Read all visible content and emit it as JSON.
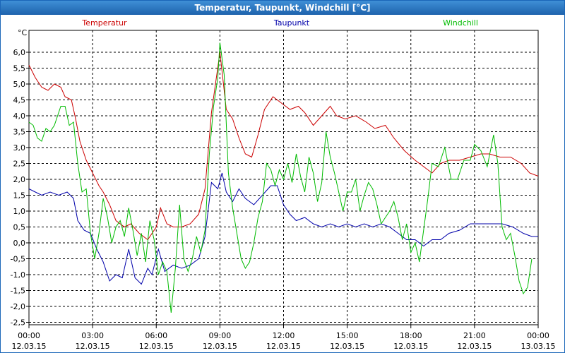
{
  "window": {
    "title": "Temperatur, Taupunkt, Windchill [°C]"
  },
  "chart_data": {
    "type": "line",
    "title": "Temperatur, Taupunkt, Windchill [°C]",
    "ylabel": "°C",
    "xlim": [
      0,
      24
    ],
    "ylim": [
      -2.5,
      6.5
    ],
    "grid": true,
    "y_ticks": [
      "-2,5",
      "-2,0",
      "-1,5",
      "-1,0",
      "-0,5",
      "0,0",
      "0,5",
      "1,0",
      "1,5",
      "2,0",
      "2,5",
      "3,0",
      "3,5",
      "4,0",
      "4,5",
      "5,0",
      "5,5",
      "6,0"
    ],
    "x_ticks": [
      {
        "time": "00:00",
        "date": "12.03.15"
      },
      {
        "time": "03:00",
        "date": "12.03.15"
      },
      {
        "time": "06:00",
        "date": "12.03.15"
      },
      {
        "time": "09:00",
        "date": "12.03.15"
      },
      {
        "time": "12:00",
        "date": "12.03.15"
      },
      {
        "time": "15:00",
        "date": "12.03.15"
      },
      {
        "time": "18:00",
        "date": "12.03.15"
      },
      {
        "time": "21:00",
        "date": "12.03.15"
      },
      {
        "time": "00:00",
        "date": "13.03.15"
      }
    ],
    "series": [
      {
        "name": "Temperatur",
        "color": "#cc0000",
        "points": [
          [
            0,
            5.6
          ],
          [
            0.3,
            5.2
          ],
          [
            0.6,
            4.9
          ],
          [
            0.9,
            4.8
          ],
          [
            1.2,
            5.0
          ],
          [
            1.5,
            4.9
          ],
          [
            1.7,
            4.6
          ],
          [
            2.0,
            4.5
          ],
          [
            2.2,
            3.9
          ],
          [
            2.4,
            3.2
          ],
          [
            2.7,
            2.6
          ],
          [
            3.0,
            2.2
          ],
          [
            3.3,
            1.8
          ],
          [
            3.5,
            1.6
          ],
          [
            3.8,
            1.2
          ],
          [
            4.1,
            0.7
          ],
          [
            4.5,
            0.5
          ],
          [
            4.8,
            0.6
          ],
          [
            5.2,
            0.3
          ],
          [
            5.6,
            0.1
          ],
          [
            6.0,
            0.5
          ],
          [
            6.2,
            1.1
          ],
          [
            6.5,
            0.6
          ],
          [
            6.8,
            0.5
          ],
          [
            7.2,
            0.5
          ],
          [
            7.6,
            0.6
          ],
          [
            8.0,
            0.9
          ],
          [
            8.3,
            1.7
          ],
          [
            8.6,
            4.1
          ],
          [
            9.0,
            6.0
          ],
          [
            9.3,
            4.2
          ],
          [
            9.6,
            3.9
          ],
          [
            9.9,
            3.3
          ],
          [
            10.2,
            2.8
          ],
          [
            10.5,
            2.7
          ],
          [
            10.8,
            3.4
          ],
          [
            11.1,
            4.2
          ],
          [
            11.5,
            4.6
          ],
          [
            11.9,
            4.4
          ],
          [
            12.3,
            4.2
          ],
          [
            12.7,
            4.3
          ],
          [
            13.0,
            4.1
          ],
          [
            13.4,
            3.7
          ],
          [
            13.8,
            4.0
          ],
          [
            14.2,
            4.3
          ],
          [
            14.5,
            4.0
          ],
          [
            14.9,
            3.9
          ],
          [
            15.4,
            4.0
          ],
          [
            15.9,
            3.8
          ],
          [
            16.3,
            3.6
          ],
          [
            16.8,
            3.7
          ],
          [
            17.2,
            3.3
          ],
          [
            17.7,
            2.9
          ],
          [
            18.2,
            2.6
          ],
          [
            18.6,
            2.4
          ],
          [
            19.0,
            2.2
          ],
          [
            19.4,
            2.5
          ],
          [
            19.8,
            2.6
          ],
          [
            20.3,
            2.6
          ],
          [
            20.8,
            2.7
          ],
          [
            21.3,
            2.8
          ],
          [
            21.7,
            2.8
          ],
          [
            22.2,
            2.7
          ],
          [
            22.7,
            2.7
          ],
          [
            23.2,
            2.5
          ],
          [
            23.6,
            2.2
          ],
          [
            24.0,
            2.1
          ]
        ]
      },
      {
        "name": "Taupunkt",
        "color": "#0000aa",
        "points": [
          [
            0,
            1.7
          ],
          [
            0.3,
            1.6
          ],
          [
            0.6,
            1.5
          ],
          [
            1.0,
            1.6
          ],
          [
            1.4,
            1.5
          ],
          [
            1.8,
            1.6
          ],
          [
            2.1,
            1.4
          ],
          [
            2.3,
            0.7
          ],
          [
            2.6,
            0.4
          ],
          [
            2.9,
            0.3
          ],
          [
            3.2,
            -0.2
          ],
          [
            3.5,
            -0.6
          ],
          [
            3.8,
            -1.2
          ],
          [
            4.1,
            -1.0
          ],
          [
            4.4,
            -1.1
          ],
          [
            4.7,
            -0.2
          ],
          [
            5.0,
            -1.1
          ],
          [
            5.3,
            -1.3
          ],
          [
            5.6,
            -0.8
          ],
          [
            5.8,
            -1.0
          ],
          [
            6.1,
            -0.2
          ],
          [
            6.4,
            -0.9
          ],
          [
            6.8,
            -0.7
          ],
          [
            7.2,
            -0.8
          ],
          [
            7.6,
            -0.7
          ],
          [
            8.0,
            -0.5
          ],
          [
            8.3,
            0.2
          ],
          [
            8.6,
            1.9
          ],
          [
            8.9,
            1.7
          ],
          [
            9.1,
            2.2
          ],
          [
            9.3,
            1.6
          ],
          [
            9.6,
            1.3
          ],
          [
            9.9,
            1.7
          ],
          [
            10.2,
            1.4
          ],
          [
            10.6,
            1.2
          ],
          [
            11.0,
            1.5
          ],
          [
            11.4,
            1.8
          ],
          [
            11.7,
            1.8
          ],
          [
            12.0,
            1.2
          ],
          [
            12.3,
            0.9
          ],
          [
            12.6,
            0.7
          ],
          [
            13.0,
            0.8
          ],
          [
            13.4,
            0.6
          ],
          [
            13.8,
            0.5
          ],
          [
            14.2,
            0.6
          ],
          [
            14.6,
            0.5
          ],
          [
            15.0,
            0.6
          ],
          [
            15.4,
            0.5
          ],
          [
            15.8,
            0.6
          ],
          [
            16.2,
            0.5
          ],
          [
            16.6,
            0.6
          ],
          [
            17.0,
            0.5
          ],
          [
            17.4,
            0.3
          ],
          [
            17.8,
            0.1
          ],
          [
            18.2,
            0.1
          ],
          [
            18.6,
            -0.1
          ],
          [
            19.0,
            0.1
          ],
          [
            19.4,
            0.1
          ],
          [
            19.8,
            0.3
          ],
          [
            20.3,
            0.4
          ],
          [
            20.8,
            0.6
          ],
          [
            21.3,
            0.6
          ],
          [
            21.8,
            0.6
          ],
          [
            22.3,
            0.6
          ],
          [
            22.8,
            0.5
          ],
          [
            23.3,
            0.3
          ],
          [
            23.7,
            0.2
          ],
          [
            24.0,
            0.2
          ]
        ]
      },
      {
        "name": "Windchill",
        "color": "#00bb00",
        "points": [
          [
            0,
            3.8
          ],
          [
            0.2,
            3.7
          ],
          [
            0.4,
            3.3
          ],
          [
            0.6,
            3.2
          ],
          [
            0.8,
            3.6
          ],
          [
            1.0,
            3.5
          ],
          [
            1.2,
            3.7
          ],
          [
            1.5,
            4.3
          ],
          [
            1.7,
            4.3
          ],
          [
            1.9,
            3.7
          ],
          [
            2.1,
            3.8
          ],
          [
            2.3,
            2.5
          ],
          [
            2.5,
            1.6
          ],
          [
            2.7,
            1.7
          ],
          [
            2.9,
            0.3
          ],
          [
            3.1,
            -0.5
          ],
          [
            3.3,
            0.3
          ],
          [
            3.5,
            1.4
          ],
          [
            3.7,
            0.8
          ],
          [
            3.9,
            0.0
          ],
          [
            4.1,
            0.5
          ],
          [
            4.3,
            0.7
          ],
          [
            4.5,
            0.2
          ],
          [
            4.7,
            1.1
          ],
          [
            4.9,
            0.4
          ],
          [
            5.1,
            -0.4
          ],
          [
            5.3,
            0.3
          ],
          [
            5.5,
            -0.6
          ],
          [
            5.7,
            0.7
          ],
          [
            5.9,
            0.1
          ],
          [
            6.1,
            -1.0
          ],
          [
            6.3,
            -0.6
          ],
          [
            6.5,
            -0.9
          ],
          [
            6.7,
            -2.2
          ],
          [
            6.9,
            -0.8
          ],
          [
            7.1,
            1.2
          ],
          [
            7.3,
            -0.5
          ],
          [
            7.5,
            -0.9
          ],
          [
            7.7,
            -0.5
          ],
          [
            7.9,
            0.2
          ],
          [
            8.1,
            -0.3
          ],
          [
            8.3,
            0.4
          ],
          [
            8.5,
            2.8
          ],
          [
            8.7,
            4.3
          ],
          [
            8.9,
            5.2
          ],
          [
            9.0,
            6.3
          ],
          [
            9.2,
            5.3
          ],
          [
            9.4,
            2.2
          ],
          [
            9.6,
            1.1
          ],
          [
            9.8,
            0.3
          ],
          [
            10.0,
            -0.5
          ],
          [
            10.2,
            -0.8
          ],
          [
            10.4,
            -0.6
          ],
          [
            10.6,
            0.0
          ],
          [
            10.8,
            0.8
          ],
          [
            11.0,
            1.3
          ],
          [
            11.2,
            2.5
          ],
          [
            11.4,
            2.3
          ],
          [
            11.6,
            1.8
          ],
          [
            11.8,
            2.3
          ],
          [
            12.0,
            2.0
          ],
          [
            12.2,
            2.5
          ],
          [
            12.4,
            1.9
          ],
          [
            12.6,
            2.8
          ],
          [
            12.8,
            2.1
          ],
          [
            13.0,
            1.6
          ],
          [
            13.2,
            2.7
          ],
          [
            13.4,
            2.2
          ],
          [
            13.6,
            1.3
          ],
          [
            13.8,
            1.9
          ],
          [
            14.0,
            3.5
          ],
          [
            14.2,
            2.7
          ],
          [
            14.4,
            2.2
          ],
          [
            14.6,
            1.6
          ],
          [
            14.8,
            1.0
          ],
          [
            15.0,
            1.6
          ],
          [
            15.2,
            1.6
          ],
          [
            15.4,
            2.0
          ],
          [
            15.6,
            1.0
          ],
          [
            15.8,
            1.5
          ],
          [
            16.0,
            1.9
          ],
          [
            16.2,
            1.7
          ],
          [
            16.4,
            1.2
          ],
          [
            16.6,
            0.6
          ],
          [
            16.8,
            0.8
          ],
          [
            17.0,
            1.0
          ],
          [
            17.2,
            1.3
          ],
          [
            17.4,
            0.8
          ],
          [
            17.6,
            0.1
          ],
          [
            17.8,
            0.6
          ],
          [
            18.0,
            -0.3
          ],
          [
            18.2,
            0.0
          ],
          [
            18.4,
            -0.6
          ],
          [
            18.6,
            0.4
          ],
          [
            18.8,
            1.4
          ],
          [
            19.0,
            2.5
          ],
          [
            19.3,
            2.4
          ],
          [
            19.6,
            3.0
          ],
          [
            19.9,
            2.0
          ],
          [
            20.2,
            2.0
          ],
          [
            20.5,
            2.6
          ],
          [
            20.8,
            2.6
          ],
          [
            21.0,
            3.1
          ],
          [
            21.3,
            2.9
          ],
          [
            21.6,
            2.4
          ],
          [
            21.9,
            3.4
          ],
          [
            22.1,
            2.5
          ],
          [
            22.3,
            0.5
          ],
          [
            22.5,
            0.1
          ],
          [
            22.7,
            0.3
          ],
          [
            22.9,
            -0.4
          ],
          [
            23.1,
            -1.2
          ],
          [
            23.3,
            -1.6
          ],
          [
            23.5,
            -1.4
          ],
          [
            23.7,
            -0.5
          ]
        ]
      }
    ]
  }
}
